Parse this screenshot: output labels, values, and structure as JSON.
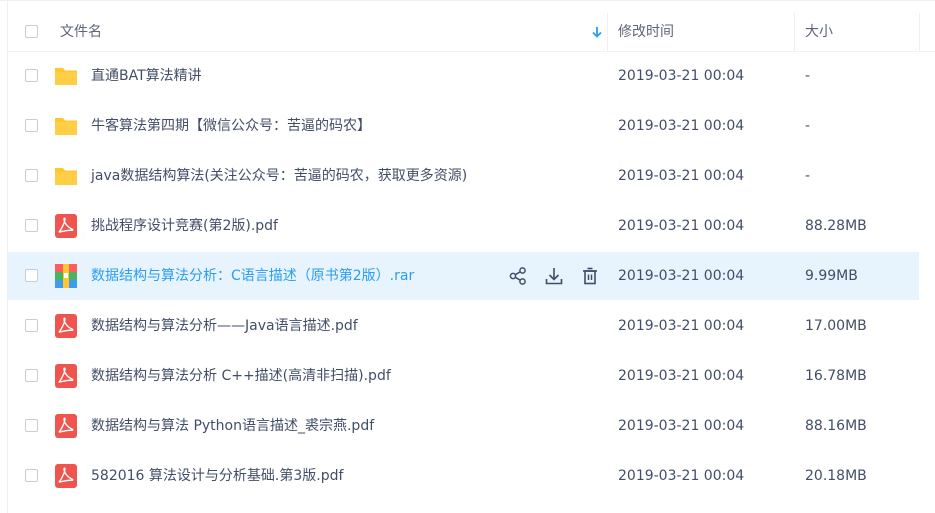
{
  "header": {
    "name_label": "文件名",
    "modified_label": "修改时间",
    "size_label": "大小"
  },
  "files": [
    {
      "name": "直通BAT算法精讲",
      "date": "2019-03-21 00:04",
      "size": "-",
      "type": "folder"
    },
    {
      "name": "牛客算法第四期【微信公众号：苦逼的码农】",
      "date": "2019-03-21 00:04",
      "size": "-",
      "type": "folder"
    },
    {
      "name": "java数据结构算法(关注公众号：苦逼的码农，获取更多资源)",
      "date": "2019-03-21 00:04",
      "size": "-",
      "type": "folder"
    },
    {
      "name": "挑战程序设计竞赛(第2版).pdf",
      "date": "2019-03-21 00:04",
      "size": "88.28MB",
      "type": "pdf"
    },
    {
      "name": "数据结构与算法分析：C语言描述（原书第2版）.rar",
      "date": "2019-03-21 00:04",
      "size": "9.99MB",
      "type": "rar"
    },
    {
      "name": "数据结构与算法分析——Java语言描述.pdf",
      "date": "2019-03-21 00:04",
      "size": "17.00MB",
      "type": "pdf"
    },
    {
      "name": "数据结构与算法分析 C++描述(高清非扫描).pdf",
      "date": "2019-03-21 00:04",
      "size": "16.78MB",
      "type": "pdf"
    },
    {
      "name": "数据结构与算法 Python语言描述_裘宗燕.pdf",
      "date": "2019-03-21 00:04",
      "size": "88.16MB",
      "type": "pdf"
    },
    {
      "name": "582016 算法设计与分析基础.第3版.pdf",
      "date": "2019-03-21 00:04",
      "size": "20.18MB",
      "type": "pdf"
    }
  ],
  "hover_actions": [
    "share-icon",
    "download-icon",
    "delete-icon"
  ],
  "colors": {
    "accent": "#2a9df4",
    "highlight_row": "#e7f3fd",
    "folder": "#ffc62e",
    "pdf": "#f0544f",
    "text": "#424e67"
  }
}
